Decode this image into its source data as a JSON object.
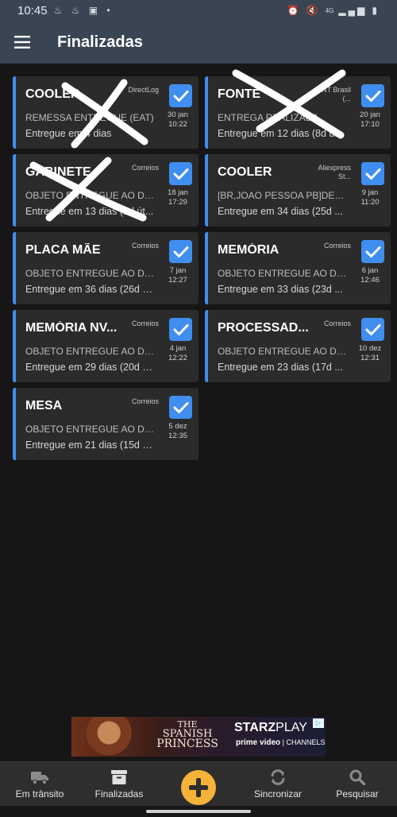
{
  "status_bar": {
    "time": "10:45",
    "network_label": "4G"
  },
  "app_bar": {
    "title": "Finalizadas",
    "menu_icon": "hamburger-menu-icon"
  },
  "orders": [
    {
      "title": "COOLER",
      "carrier": "DirectLog",
      "status": "REMESSA ENTREGUE (EAT)",
      "delivery": "Entregue em 4 dias",
      "date": "30 jan",
      "time": "10:22",
      "checked": true,
      "crossed_out": true
    },
    {
      "title": "FONTE",
      "carrier": "TNT Brasil (...",
      "status": "ENTREGA REALIZADA",
      "delivery": "Entregue em 12 dias (8d ú...",
      "date": "20 jan",
      "time": "17:10",
      "checked": true,
      "crossed_out": true
    },
    {
      "title": "GABINETE",
      "carrier": "Correios",
      "status": "OBJETO ENTREGUE AO DE...",
      "delivery": "Entregue em 13 dias (9d út...",
      "date": "18 jan",
      "time": "17:29",
      "checked": true,
      "crossed_out": true
    },
    {
      "title": "COOLER",
      "carrier": "Aliexpress St...",
      "status": "[BR,JOAO PESSOA PB]DEL...",
      "delivery": "Entregue em 34 dias (25d ...",
      "date": "9 jan",
      "time": "11:20",
      "checked": true,
      "crossed_out": false
    },
    {
      "title": "PLACA MÃE",
      "carrier": "Correios",
      "status": "OBJETO ENTREGUE AO DE...",
      "delivery": "Entregue em 36 dias (26d ú...",
      "date": "7 jan",
      "time": "12:27",
      "checked": true,
      "crossed_out": false
    },
    {
      "title": "MEMÓRIA",
      "carrier": "Correios",
      "status": "OBJETO ENTREGUE AO DE...",
      "delivery": "Entregue em 33 dias (23d ...",
      "date": "6 jan",
      "time": "12:46",
      "checked": true,
      "crossed_out": false
    },
    {
      "title": "MEMÓRIA NV...",
      "carrier": "Correios",
      "status": "OBJETO ENTREGUE AO DE...",
      "delivery": "Entregue em 29 dias (20d ú...",
      "date": "4 jan",
      "time": "12:22",
      "checked": true,
      "crossed_out": false
    },
    {
      "title": "PROCESSAD...",
      "carrier": "Correios",
      "status": "OBJETO ENTREGUE AO DE...",
      "delivery": "Entregue em 23 dias (17d ...",
      "date": "10 dez",
      "time": "12:31",
      "checked": true,
      "crossed_out": false
    },
    {
      "title": "MESA",
      "carrier": "Correios",
      "status": "OBJETO ENTREGUE AO DE...",
      "delivery": "Entregue em 21 dias (15d ú...",
      "date": "5 dez",
      "time": "12:35",
      "checked": true,
      "crossed_out": false
    }
  ],
  "ad": {
    "show_title_line1": "THE",
    "show_title_line2": "SPANISH",
    "show_title_line3": "PRINCESS",
    "brand_bold": "STARZ",
    "brand_thin": "PLAY",
    "partner_name": "prime video",
    "partner_suffix": "| CHANNELS",
    "ad_choices_icon": "ad-choices-icon"
  },
  "bottom_nav": {
    "items": [
      {
        "label": "Em trânsito",
        "icon": "truck-icon"
      },
      {
        "label": "Finalizadas",
        "icon": "archive-box-icon"
      },
      {
        "label": "Sincronizar",
        "icon": "sync-icon"
      },
      {
        "label": "Pesquisar",
        "icon": "search-icon"
      }
    ],
    "fab_icon": "plus-icon"
  },
  "colors": {
    "app_bar": "#394553",
    "background": "#161616",
    "card": "#2b2b2b",
    "accent_blue": "#3f8ef0",
    "fab_orange": "#f6b33a"
  }
}
